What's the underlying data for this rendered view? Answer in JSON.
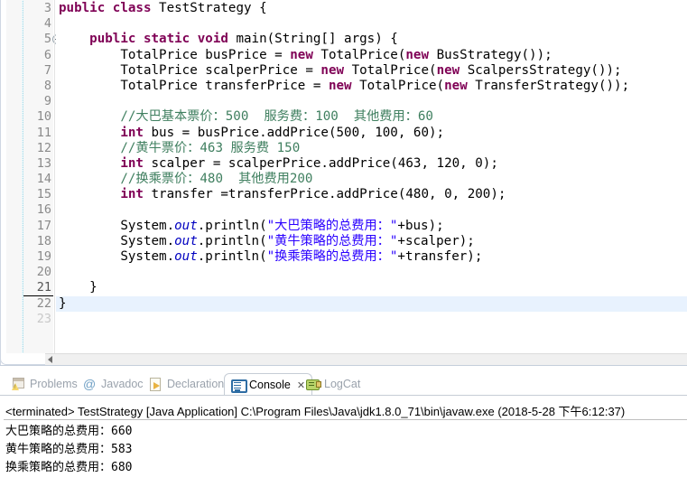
{
  "editor": {
    "first_line_number": 3,
    "current_line": 21,
    "lines": [
      {
        "n": 3,
        "fold": false,
        "highlight": false,
        "tokens": [
          {
            "t": "kw",
            "s": "public class "
          },
          {
            "t": "pl",
            "s": "TestStrategy {"
          }
        ]
      },
      {
        "n": 4,
        "fold": false,
        "highlight": false,
        "tokens": []
      },
      {
        "n": 5,
        "fold": true,
        "highlight": false,
        "tokens": [
          {
            "t": "pl",
            "s": "    "
          },
          {
            "t": "kw",
            "s": "public static void "
          },
          {
            "t": "pl",
            "s": "main(String[] args) {"
          }
        ]
      },
      {
        "n": 6,
        "fold": false,
        "highlight": false,
        "tokens": [
          {
            "t": "pl",
            "s": "        TotalPrice busPrice = "
          },
          {
            "t": "kw",
            "s": "new "
          },
          {
            "t": "pl",
            "s": "TotalPrice("
          },
          {
            "t": "kw",
            "s": "new "
          },
          {
            "t": "pl",
            "s": "BusStrategy());"
          }
        ]
      },
      {
        "n": 7,
        "fold": false,
        "highlight": false,
        "tokens": [
          {
            "t": "pl",
            "s": "        TotalPrice scalperPrice = "
          },
          {
            "t": "kw",
            "s": "new "
          },
          {
            "t": "pl",
            "s": "TotalPrice("
          },
          {
            "t": "kw",
            "s": "new "
          },
          {
            "t": "pl",
            "s": "ScalpersStrategy());"
          }
        ]
      },
      {
        "n": 8,
        "fold": false,
        "highlight": false,
        "tokens": [
          {
            "t": "pl",
            "s": "        TotalPrice transferPrice = "
          },
          {
            "t": "kw",
            "s": "new "
          },
          {
            "t": "pl",
            "s": "TotalPrice("
          },
          {
            "t": "kw",
            "s": "new "
          },
          {
            "t": "pl",
            "s": "TransferStrategy());"
          }
        ]
      },
      {
        "n": 9,
        "fold": false,
        "highlight": false,
        "tokens": []
      },
      {
        "n": 10,
        "fold": false,
        "highlight": false,
        "tokens": [
          {
            "t": "pl",
            "s": "        "
          },
          {
            "t": "cmt",
            "s": "//大巴基本票价：500  服务费：100  其他费用：60"
          }
        ]
      },
      {
        "n": 11,
        "fold": false,
        "highlight": false,
        "tokens": [
          {
            "t": "pl",
            "s": "        "
          },
          {
            "t": "kw",
            "s": "int "
          },
          {
            "t": "pl",
            "s": "bus = busPrice.addPrice(500, 100, 60);"
          }
        ]
      },
      {
        "n": 12,
        "fold": false,
        "highlight": false,
        "tokens": [
          {
            "t": "pl",
            "s": "        "
          },
          {
            "t": "cmt",
            "s": "//黄牛票价：463 服务费 150"
          }
        ]
      },
      {
        "n": 13,
        "fold": false,
        "highlight": false,
        "tokens": [
          {
            "t": "pl",
            "s": "        "
          },
          {
            "t": "kw",
            "s": "int "
          },
          {
            "t": "pl",
            "s": "scalper = scalperPrice.addPrice(463, 120, 0);"
          }
        ]
      },
      {
        "n": 14,
        "fold": false,
        "highlight": false,
        "tokens": [
          {
            "t": "pl",
            "s": "        "
          },
          {
            "t": "cmt",
            "s": "//换乘票价：480  其他费用200"
          }
        ]
      },
      {
        "n": 15,
        "fold": false,
        "highlight": false,
        "tokens": [
          {
            "t": "pl",
            "s": "        "
          },
          {
            "t": "kw",
            "s": "int "
          },
          {
            "t": "pl",
            "s": "transfer =transferPrice.addPrice(480, 0, 200);"
          }
        ]
      },
      {
        "n": 16,
        "fold": false,
        "highlight": false,
        "tokens": []
      },
      {
        "n": 17,
        "fold": false,
        "highlight": false,
        "tokens": [
          {
            "t": "pl",
            "s": "        System."
          },
          {
            "t": "fld",
            "s": "out"
          },
          {
            "t": "pl",
            "s": ".println("
          },
          {
            "t": "str",
            "s": "\"大巴策略的总费用："
          },
          {
            "t": "str",
            "s": "\""
          },
          {
            "t": "pl",
            "s": "+bus);"
          }
        ]
      },
      {
        "n": 18,
        "fold": false,
        "highlight": false,
        "tokens": [
          {
            "t": "pl",
            "s": "        System."
          },
          {
            "t": "fld",
            "s": "out"
          },
          {
            "t": "pl",
            "s": ".println("
          },
          {
            "t": "str",
            "s": "\"黄牛策略的总费用："
          },
          {
            "t": "str",
            "s": "\""
          },
          {
            "t": "pl",
            "s": "+scalper);"
          }
        ]
      },
      {
        "n": 19,
        "fold": false,
        "highlight": false,
        "tokens": [
          {
            "t": "pl",
            "s": "        System."
          },
          {
            "t": "fld",
            "s": "out"
          },
          {
            "t": "pl",
            "s": ".println("
          },
          {
            "t": "str",
            "s": "\"换乘策略的总费用："
          },
          {
            "t": "str",
            "s": "\""
          },
          {
            "t": "pl",
            "s": "+transfer);"
          }
        ]
      },
      {
        "n": 20,
        "fold": false,
        "highlight": false,
        "tokens": []
      },
      {
        "n": 21,
        "fold": false,
        "highlight": false,
        "tokens": [
          {
            "t": "pl",
            "s": "    }"
          }
        ]
      },
      {
        "n": 22,
        "fold": false,
        "highlight": true,
        "tokens": [
          {
            "t": "pl",
            "s": "}"
          }
        ]
      }
    ],
    "colors": {
      "keyword": "#7F0055",
      "string": "#2A00FF",
      "comment": "#3F7F5F",
      "field": "#0000C0",
      "current_line_highlight": "#E8F2FE",
      "change_bar": "#A8DBE8"
    }
  },
  "bottom_view": {
    "tabs": [
      {
        "label": "Problems",
        "icon": "problems-icon",
        "active": false,
        "closable": false
      },
      {
        "label": "Javadoc",
        "icon": "at-icon",
        "active": false,
        "closable": false
      },
      {
        "label": "Declaration",
        "icon": "declaration-icon",
        "active": false,
        "closable": false
      },
      {
        "label": "Console",
        "icon": "console-icon",
        "active": true,
        "closable": true
      },
      {
        "label": "LogCat",
        "icon": "logcat-icon",
        "active": false,
        "closable": false
      }
    ],
    "close_glyph": "✕",
    "launch_header": "<terminated> TestStrategy [Java Application] C:\\Program Files\\Java\\jdk1.8.0_71\\bin\\javaw.exe (2018-5-28 下午6:12:37)",
    "output_lines": [
      "大巴策略的总费用：660",
      "黄牛策略的总费用：583",
      "换乘策略的总费用：680"
    ]
  }
}
